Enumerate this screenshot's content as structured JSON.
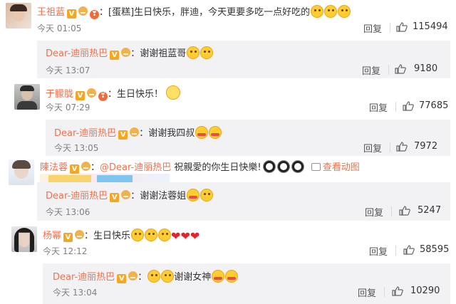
{
  "comments": [
    {
      "user": "王祖蓝",
      "text": "：[蛋糕]生日快乐，胖迪，今天更要多吃一点好吃的",
      "time": "今天 01:05",
      "reply_label": "回复",
      "likes": "115494",
      "reply": {
        "user": "Dear-迪丽热巴",
        "text": "：谢谢祖蓝哥",
        "time": "今天 13:07",
        "reply_label": "回复",
        "likes": "9180"
      }
    },
    {
      "user": "于朦胧",
      "text": "：生日快乐！",
      "time": "今天 07:29",
      "reply_label": "回复",
      "likes": "77685",
      "reply": {
        "user": "Dear-迪丽热巴",
        "text": "：谢谢我四叔",
        "time": "今天 13:05",
        "reply_label": "回复",
        "likes": "7972"
      }
    },
    {
      "user": "陳法蓉",
      "text_prefix": "：",
      "mention": "@Dear-迪丽热巴",
      "text": " 祝親愛的你生日快樂!",
      "view_image_label": "查看动图",
      "reply": {
        "user": "Dear-迪丽热巴",
        "text": "：谢谢法蓉姐",
        "time": "今天 13:06",
        "reply_label": "回复",
        "likes": "5247"
      }
    },
    {
      "user": "杨幂",
      "text": "：生日快乐",
      "time": "今天 12:12",
      "reply_label": "回复",
      "likes": "58595",
      "reply": {
        "user": "Dear-迪丽热巴",
        "text_a": "：",
        "text": "谢谢女神",
        "time": "今天 13:04",
        "reply_label": "回复",
        "likes": "10290"
      }
    }
  ],
  "colors": {
    "accent": "#eb7350",
    "reply_bg": "#f2f2f5",
    "heart": "#e6222a"
  }
}
